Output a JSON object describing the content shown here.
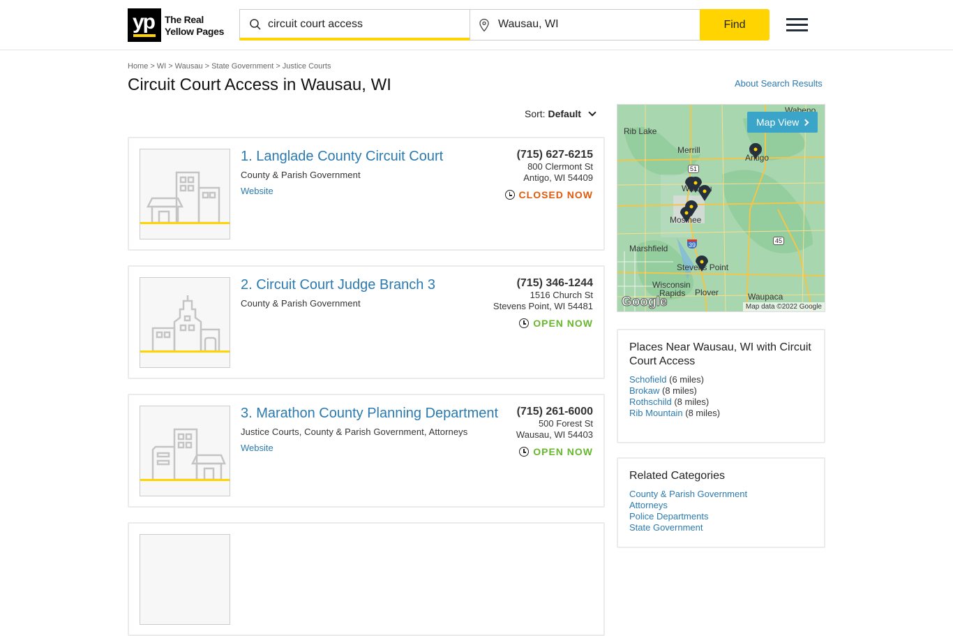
{
  "header": {
    "logo_mark": "yp",
    "logo_text_line1": "The Real",
    "logo_text_line2": "Yellow Pages",
    "search_value": "circuit court access",
    "location_value": "Wausau, WI",
    "find_label": "Find"
  },
  "breadcrumb": [
    "Home",
    "WI",
    "Wausau",
    "State Government",
    "Justice Courts"
  ],
  "page_title": "Circuit Court Access in Wausau, WI",
  "about_link": "About Search Results",
  "sort": {
    "label": "Sort:",
    "value": "Default"
  },
  "results": [
    {
      "name": "1. Langlade County Circuit Court",
      "categories": "County & Parish Government",
      "website": "Website",
      "phone": "(715) 627-6215",
      "street": "800 Clermont St",
      "city": "Antigo, WI 54409",
      "status": "CLOSED NOW"
    },
    {
      "name": "2. Circuit Court Judge Branch 3",
      "categories": "County & Parish Government",
      "phone": "(715) 346-1244",
      "street": "1516 Church St",
      "city": "Stevens Point, WI 54481",
      "status": "OPEN NOW"
    },
    {
      "name": "3. Marathon County Planning Department",
      "categories": "Justice Courts, County & Parish Government, Attorneys",
      "website": "Website",
      "phone": "(715) 261-6000",
      "street": "500 Forest St",
      "city": "Wausau, WI 54403",
      "status": "OPEN NOW"
    }
  ],
  "map": {
    "button_label": "Map View",
    "labels": [
      "Wabeno",
      "Rib Lake",
      "Merrill",
      "Antigo",
      "Wausau",
      "Mosinee",
      "Marshfield",
      "Stevens Point",
      "Wisconsin",
      "Rapids",
      "Plover",
      "Waupaca"
    ],
    "highways": [
      "51",
      "39",
      "45"
    ],
    "attribution": "Map data ©2022 Google",
    "google_logo": "Google"
  },
  "nearby": {
    "title": "Places Near Wausau, WI with Circuit Court Access",
    "places": [
      {
        "name": "Schofield",
        "distance": "(6 miles)"
      },
      {
        "name": "Brokaw",
        "distance": "(8 miles)"
      },
      {
        "name": "Rothschild",
        "distance": "(8 miles)"
      },
      {
        "name": "Rib Mountain",
        "distance": "(8 miles)"
      }
    ]
  },
  "related": {
    "title": "Related Categories",
    "items": [
      "County & Parish Government",
      "Attorneys",
      "Police Departments",
      "State Government"
    ]
  },
  "colors": {
    "brand_yellow": "#ffd400",
    "link_blue": "#2a7ab0",
    "closed_orange": "#e05a0c",
    "open_green": "#67b72e",
    "map_button": "#3aa5c8"
  }
}
